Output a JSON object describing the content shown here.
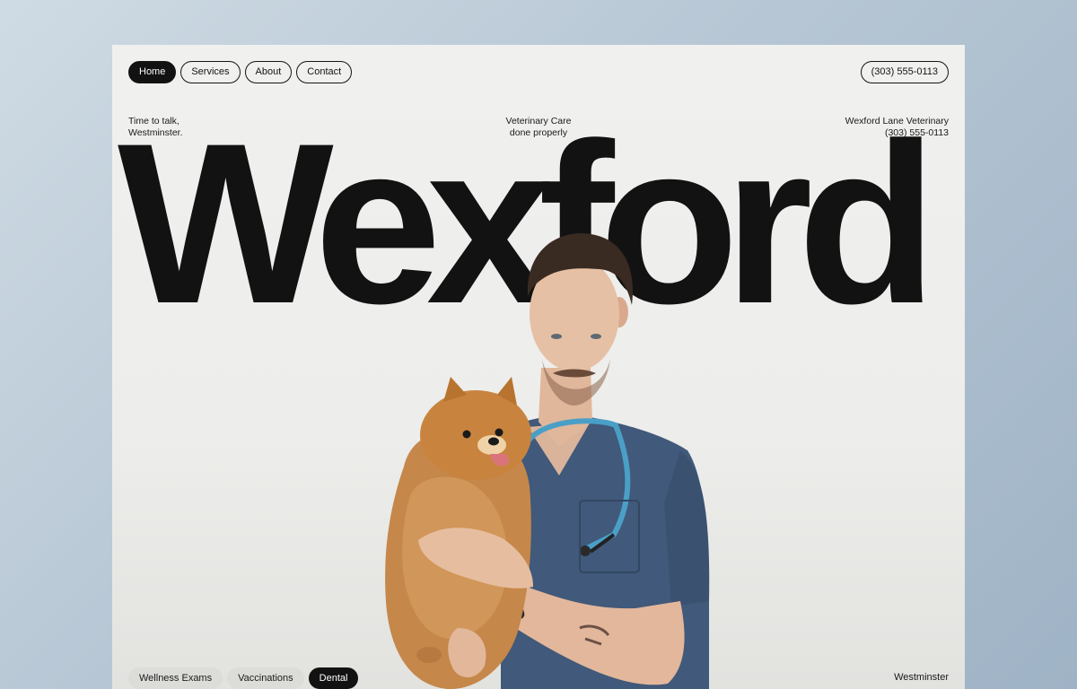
{
  "nav": {
    "items": [
      {
        "label": "Home",
        "active": true
      },
      {
        "label": "Services",
        "active": false
      },
      {
        "label": "About",
        "active": false
      },
      {
        "label": "Contact",
        "active": false
      }
    ],
    "phone": "(303) 555-0113"
  },
  "info": {
    "left": [
      "Time to talk,",
      "Westminster."
    ],
    "center": [
      "Veterinary Care",
      "done properly"
    ],
    "right": [
      "Wexford Lane Veterinary",
      "(303) 555-0113"
    ]
  },
  "hero": {
    "wordmark": "Wexford"
  },
  "services": {
    "tags": [
      {
        "label": "Wellness Exams",
        "active": false
      },
      {
        "label": "Vaccinations",
        "active": false
      },
      {
        "label": "Dental",
        "active": true
      }
    ]
  },
  "footer": {
    "location": "Westminster"
  },
  "colors": {
    "ink": "#121212",
    "paper": "#efefed",
    "scrubs": "#3f5a78",
    "stethoscope": "#4a9fc6",
    "fur": "#c8843e"
  }
}
